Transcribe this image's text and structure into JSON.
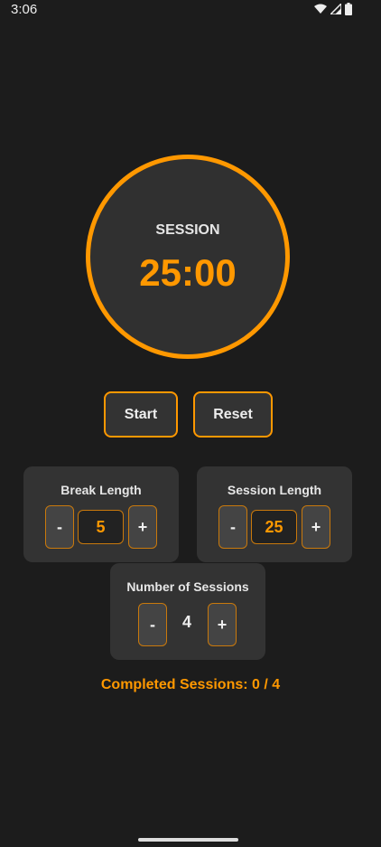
{
  "status_bar": {
    "time": "3:06"
  },
  "timer": {
    "label": "SESSION",
    "time": "25:00"
  },
  "controls": {
    "start": "Start",
    "reset": "Reset"
  },
  "break": {
    "title": "Break Length",
    "minus": "-",
    "value": "5",
    "plus": "+"
  },
  "session": {
    "title": "Session Length",
    "minus": "-",
    "value": "25",
    "plus": "+"
  },
  "sessions": {
    "title": "Number of Sessions",
    "minus": "-",
    "value": "4",
    "plus": "+"
  },
  "completed": "Completed Sessions: 0 / 4",
  "colors": {
    "accent": "#ff9800",
    "background": "#1c1c1c",
    "card": "#333333"
  }
}
